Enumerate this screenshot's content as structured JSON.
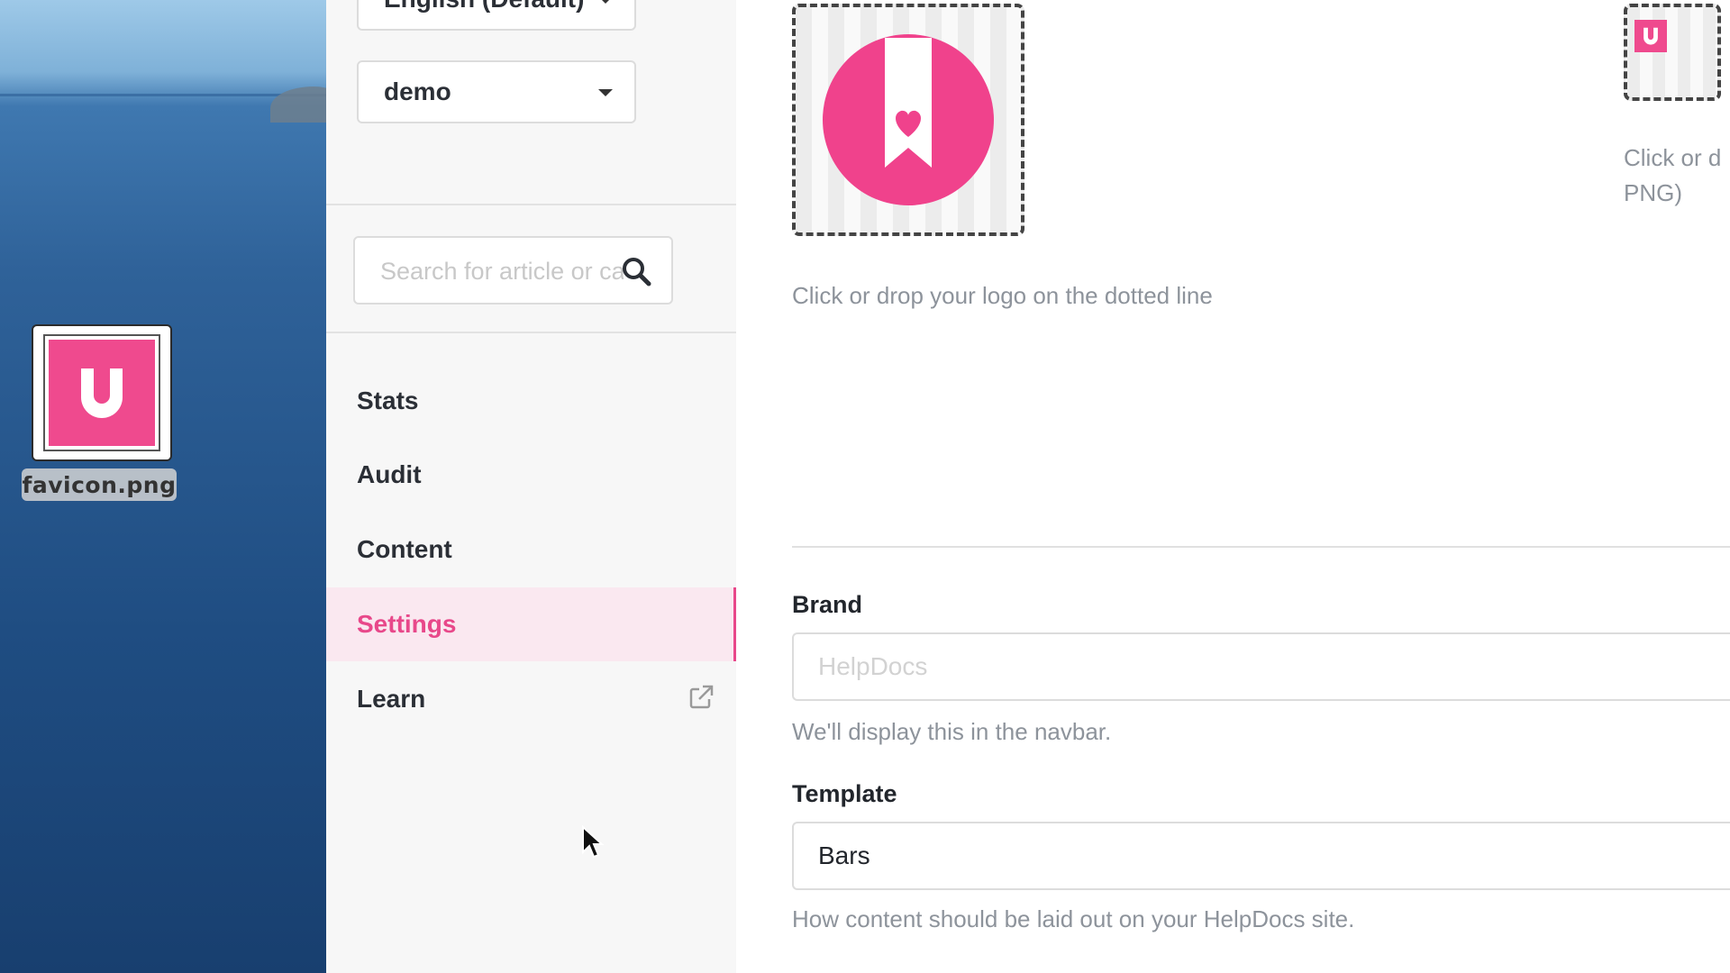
{
  "desktop": {
    "file_label": "favicon.png"
  },
  "sidebar": {
    "language_select": "English (Default)",
    "site_select": "demo",
    "search_placeholder": "Search for article or cat",
    "nav": {
      "stats": "Stats",
      "audit": "Audit",
      "content": "Content",
      "settings": "Settings",
      "learn": "Learn"
    },
    "active_item": "Settings"
  },
  "main": {
    "logo_hint": "Click or drop your logo on the dotted line",
    "favicon_hint_line1": "Click or d",
    "favicon_hint_line2": "PNG)",
    "brand": {
      "label": "Brand",
      "placeholder": "HelpDocs",
      "value": "",
      "help": "We'll display this in the navbar."
    },
    "template": {
      "label": "Template",
      "value": "Bars",
      "help": "How content should be laid out on your HelpDocs site."
    }
  },
  "colors": {
    "accent": "#e8488a",
    "active_bg": "#fae8f0",
    "sidebar_bg": "#f7f7f7",
    "help_text": "#8d939b"
  },
  "icons": [
    "search-icon",
    "external-link-icon",
    "caret-down-icon",
    "logo-icon",
    "favicon-icon",
    "cursor-arrow-icon"
  ]
}
